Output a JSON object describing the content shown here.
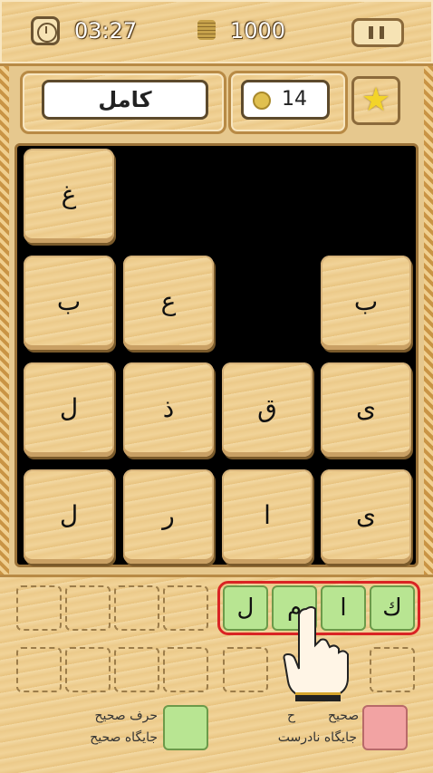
{
  "top_bar": {
    "time": "03:27",
    "coins": "1000"
  },
  "header": {
    "word": "كامل",
    "hint_count": "14"
  },
  "board": {
    "tiles": [
      "غ",
      "ب",
      "ع",
      "ب",
      "ل",
      "ذ",
      "ق",
      "ى",
      "ل",
      "ر",
      "ا",
      "ى"
    ]
  },
  "answer": {
    "letters": [
      "ك",
      "ا",
      "م",
      "ل"
    ]
  },
  "legend": {
    "correct_letter": "حرف صحيح",
    "correct_position": "جایگاه صحیح",
    "wrong_position": "جایگاه نادرست",
    "wrong_letter_partial": "صحیح",
    "wrong_letter_initial": "ح"
  },
  "colors": {
    "correct": "#b8e592",
    "wrong": "#f2a3a3",
    "highlight": "#d92424"
  },
  "icons": [
    "clock-icon",
    "coins-icon",
    "pause-icon",
    "coin-icon",
    "star-icon",
    "pointing-hand-icon"
  ]
}
